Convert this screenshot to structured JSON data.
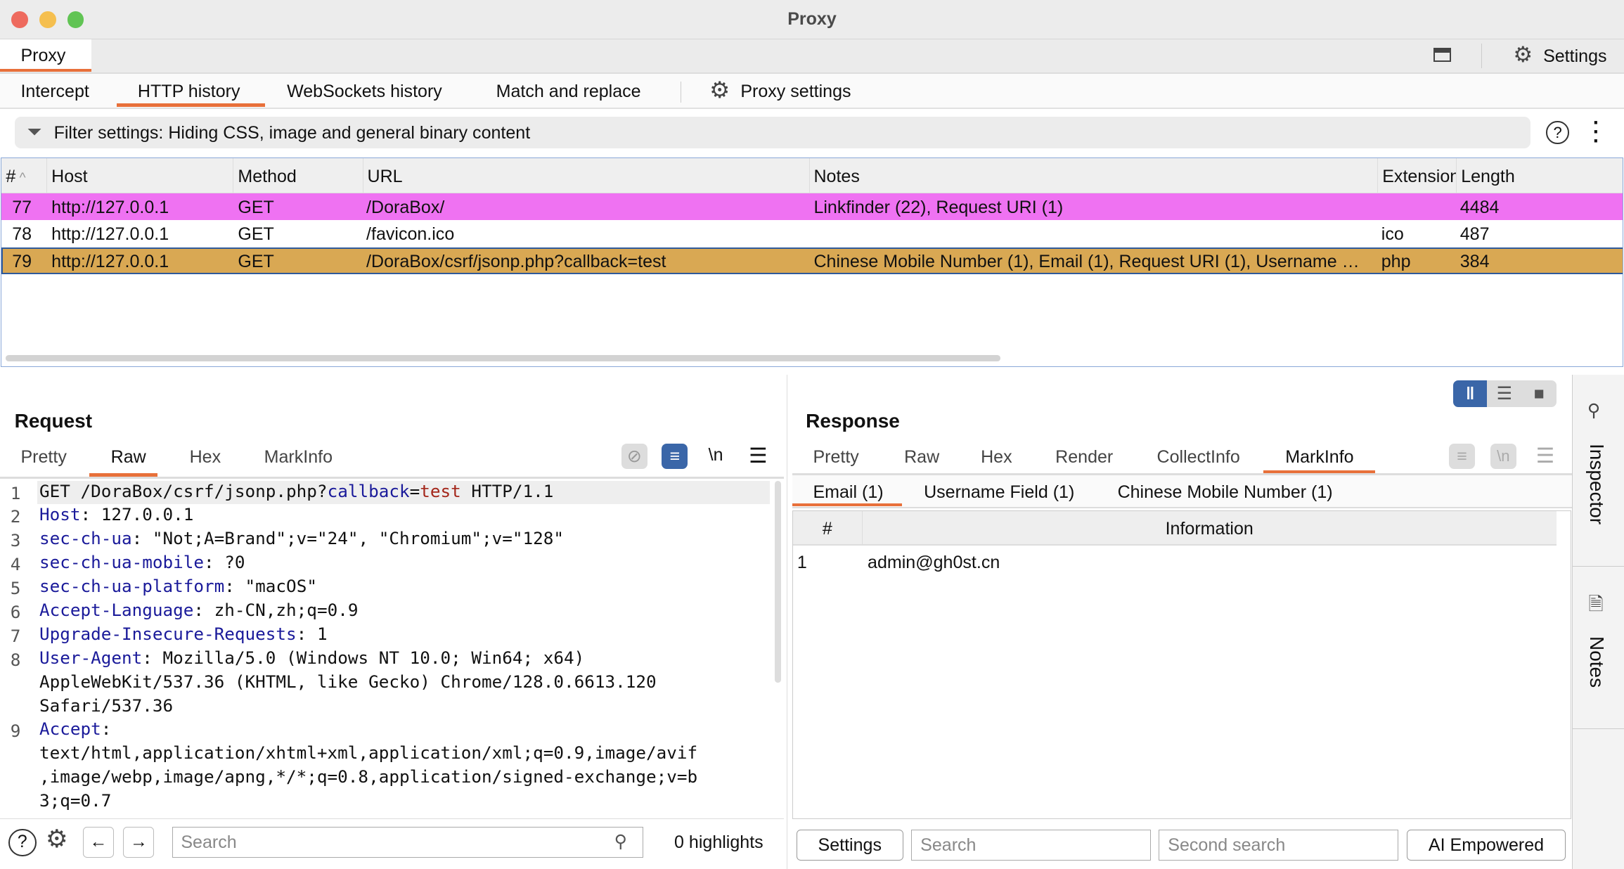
{
  "window": {
    "title": "Proxy"
  },
  "top_tabs": {
    "active": "Proxy",
    "settings_label": "Settings"
  },
  "sub_tabs": [
    {
      "label": "Intercept"
    },
    {
      "label": "HTTP history"
    },
    {
      "label": "WebSockets history"
    },
    {
      "label": "Match and replace"
    }
  ],
  "proxy_settings_label": "Proxy settings",
  "filter": {
    "text": "Filter settings: Hiding CSS, image and general binary content"
  },
  "table": {
    "columns": [
      "#",
      "Host",
      "Method",
      "URL",
      "Notes",
      "Extension",
      "Length"
    ],
    "rows": [
      {
        "num": "77",
        "host": "http://127.0.0.1",
        "method": "GET",
        "url": "/DoraBox/",
        "notes": "Linkfinder (22), Request URI (1)",
        "ext": "",
        "length": "4484",
        "color": "#ef72f2"
      },
      {
        "num": "78",
        "host": "http://127.0.0.1",
        "method": "GET",
        "url": "/favicon.ico",
        "notes": "",
        "ext": "ico",
        "length": "487",
        "color": "#ffffff"
      },
      {
        "num": "79",
        "host": "http://127.0.0.1",
        "method": "GET",
        "url": "/DoraBox/csrf/jsonp.php?callback=test",
        "notes": "Chinese Mobile Number (1), Email (1), Request URI (1), Username …",
        "ext": "php",
        "length": "384",
        "color": "#d9a853"
      }
    ]
  },
  "request": {
    "title": "Request",
    "tabs": [
      "Pretty",
      "Raw",
      "Hex",
      "MarkInfo"
    ],
    "active_tab": "Raw",
    "newline_label": "\\n",
    "line1": {
      "a": "GET /DoraBox/csrf/jsonp.php?",
      "param": "callback",
      "eq": "=",
      "val": "test",
      "rest": " HTTP/1.1"
    },
    "lines": [
      {
        "n": "2",
        "key": "Host",
        "value": " 127.0.0.1"
      },
      {
        "n": "3",
        "key": "sec-ch-ua",
        "value": " \"Not;A=Brand\";v=\"24\", \"Chromium\";v=\"128\""
      },
      {
        "n": "4",
        "key": "sec-ch-ua-mobile",
        "value": " ?0"
      },
      {
        "n": "5",
        "key": "sec-ch-ua-platform",
        "value": " \"macOS\""
      },
      {
        "n": "6",
        "key": "Accept-Language",
        "value": " zh-CN,zh;q=0.9"
      },
      {
        "n": "7",
        "key": "Upgrade-Insecure-Requests",
        "value": " 1"
      },
      {
        "n": "8",
        "key": "User-Agent",
        "value": " Mozilla/5.0 (Windows NT 10.0; Win64; x64)"
      },
      {
        "n": "",
        "key": "",
        "value": "AppleWebKit/537.36 (KHTML, like Gecko) Chrome/128.0.6613.120"
      },
      {
        "n": "",
        "key": "",
        "value": "Safari/537.36"
      },
      {
        "n": "9",
        "key": "Accept",
        "value": ""
      },
      {
        "n": "",
        "key": "",
        "value": "text/html,application/xhtml+xml,application/xml;q=0.9,image/avif"
      },
      {
        "n": "",
        "key": "",
        "value": ",image/webp,image/apng,*/*;q=0.8,application/signed-exchange;v=b"
      },
      {
        "n": "",
        "key": "",
        "value": "3;q=0.7"
      }
    ],
    "search_placeholder": "Search",
    "highlights": "0 highlights"
  },
  "response": {
    "title": "Response",
    "tabs": [
      "Pretty",
      "Raw",
      "Hex",
      "Render",
      "CollectInfo",
      "MarkInfo"
    ],
    "active_tab": "MarkInfo",
    "newline_label": "\\n",
    "mark_tabs": [
      "Email (1)",
      "Username Field (1)",
      "Chinese Mobile Number (1)"
    ],
    "mark_columns": [
      "#",
      "Information"
    ],
    "mark_rows": [
      {
        "num": "1",
        "info": "admin@gh0st.cn"
      }
    ],
    "settings_label": "Settings",
    "search_placeholder": "Search",
    "second_search_placeholder": "Second search",
    "ai_label": "AI Empowered"
  },
  "sidebar": {
    "inspector": "Inspector",
    "notes": "Notes"
  },
  "colors": {
    "accent": "#e8703a",
    "selected_blue": "#3a66a8"
  }
}
